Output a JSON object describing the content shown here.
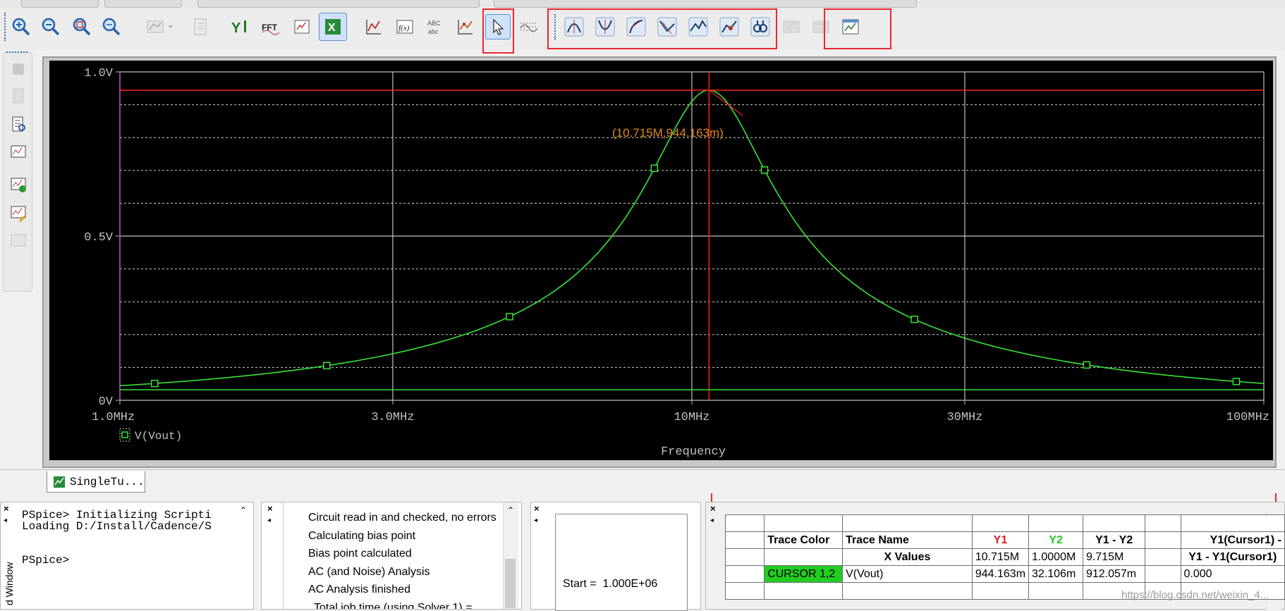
{
  "toolbar": {
    "icons": [
      "zoom-in-icon",
      "zoom-out-icon",
      "zoom-area-icon",
      "zoom-fit-icon",
      "log-axis-icon",
      "doc-icon",
      "add-y-axis-icon",
      "fft-icon",
      "performance-icon",
      "excel-icon",
      "add-trace-icon",
      "eval-goal-icon",
      "text-label-icon",
      "mark-label-icon",
      "cursor-select-icon",
      "grid-icon",
      "cursor-peak-icon",
      "cursor-trough-icon",
      "cursor-slope-icon",
      "cursor-min-icon",
      "cursor-max-icon",
      "cursor-point-icon",
      "cursor-search-icon",
      "next-transition-icon",
      "prev-transition-icon",
      "mark-data-points-icon"
    ],
    "fft_label": "FFT",
    "abc_label": "ABC"
  },
  "plot": {
    "y_ticks": [
      "1.0V",
      "0.5V",
      "0V"
    ],
    "x_ticks": [
      "1.0MHz",
      "3.0MHz",
      "10MHz",
      "30MHz",
      "100MHz"
    ],
    "xlabel": "Frequency",
    "legend": "V(Vout)",
    "cursor_label": "(10.715M,944.163m)",
    "colors": {
      "trace": "#36e336",
      "cursor": "#ff2020",
      "cursor2": "#36e336",
      "label": "#e08a1e",
      "axis": "#c0c0c0"
    }
  },
  "chart_data": {
    "type": "line",
    "xlabel": "Frequency",
    "ylabel": "",
    "x_scale": "log",
    "xlim": [
      1000000,
      100000000
    ],
    "ylim": [
      0,
      1.0
    ],
    "grid": true,
    "series": [
      {
        "name": "V(Vout)",
        "peak_x": 10715000,
        "peak_y": 0.944163
      }
    ],
    "cursor1": {
      "x": 10715000,
      "y": 0.944163
    },
    "cursor2": {
      "x": 1000000,
      "y": 0.032106
    }
  },
  "tab": {
    "label": "SingleTu..."
  },
  "console": {
    "lines": [
      "PSpice> Initializing Scripti",
      "Loading D:/Install/Cadence/S",
      "",
      "",
      "PSpice>"
    ],
    "side_label": "d Window"
  },
  "messages": {
    "lines": [
      "Circuit read in and checked, no errors",
      "Calculating bias point",
      "Bias point calculated",
      "AC (and Noise) Analysis",
      "AC Analysis finished",
      "Total job time (using Solver 1)  ="
    ]
  },
  "sim": {
    "start": "Start =  1.000E+06"
  },
  "cursor_table": {
    "h_trace_color": "Trace Color",
    "h_trace_name": "Trace Name",
    "h_y1": "Y1",
    "h_y2": "Y2",
    "h_y1y2": "Y1 - Y2",
    "h_y1c1": "Y1(Cursor1) -",
    "r1_xvalues": "X Values",
    "r1_y1": "10.715M",
    "r1_y2": "1.0000M",
    "r1_y1y2": "9.715M",
    "r1_y1c1": "Y1 - Y1(Cursor1)",
    "r2_color": "CURSOR 1,2",
    "r2_name": "V(Vout)",
    "r2_y1": "944.163m",
    "r2_y2": "32.106m",
    "r2_y1y2": "912.057m",
    "r2_y1c1": "0.000"
  },
  "watermark": "https://blog.csdn.net/weixin_4..."
}
